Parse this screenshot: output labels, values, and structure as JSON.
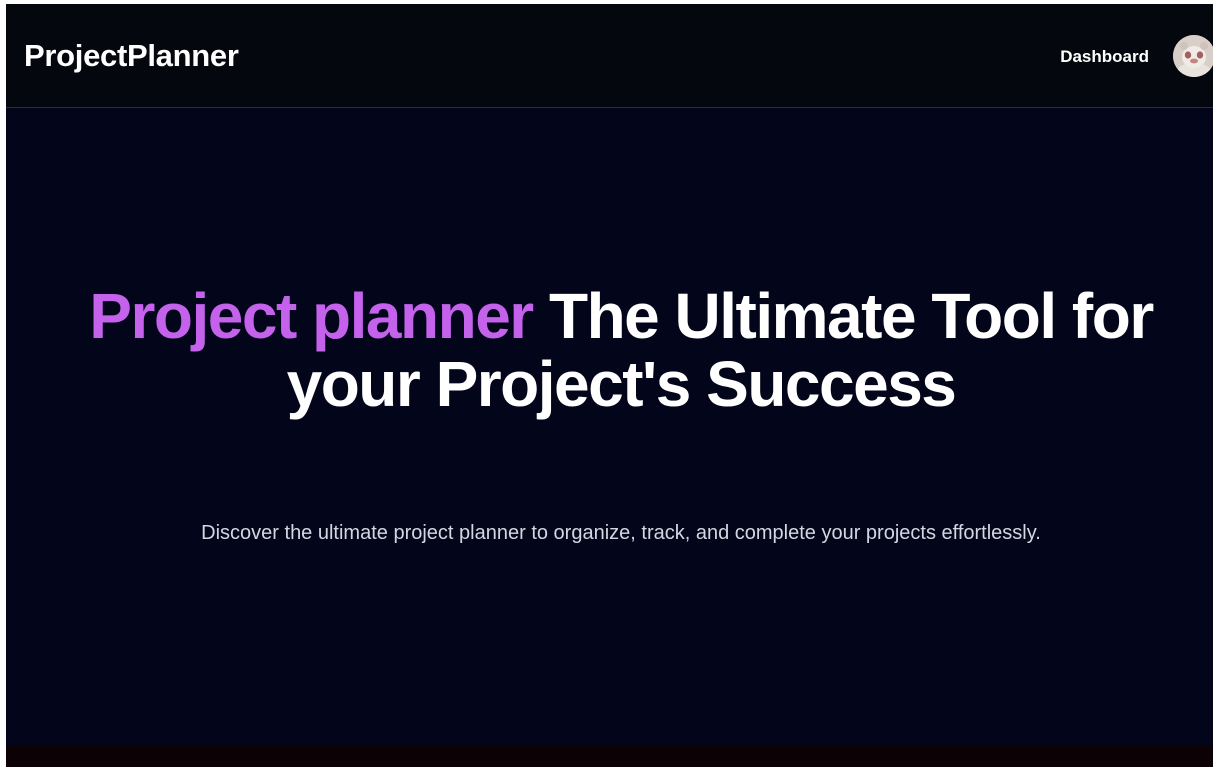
{
  "header": {
    "brand": "ProjectPlanner",
    "nav_dashboard": "Dashboard"
  },
  "hero": {
    "title_accent": "Project planner",
    "title_rest": "The Ultimate Tool for your Project's Success",
    "subtitle": "Discover the ultimate project planner to organize, track, and complete your projects effortlessly."
  },
  "colors": {
    "background": "#03061a",
    "navbar": "#05070e",
    "accent": "#c462ec",
    "text": "#ffffff",
    "muted_text": "#d4d6e2"
  }
}
